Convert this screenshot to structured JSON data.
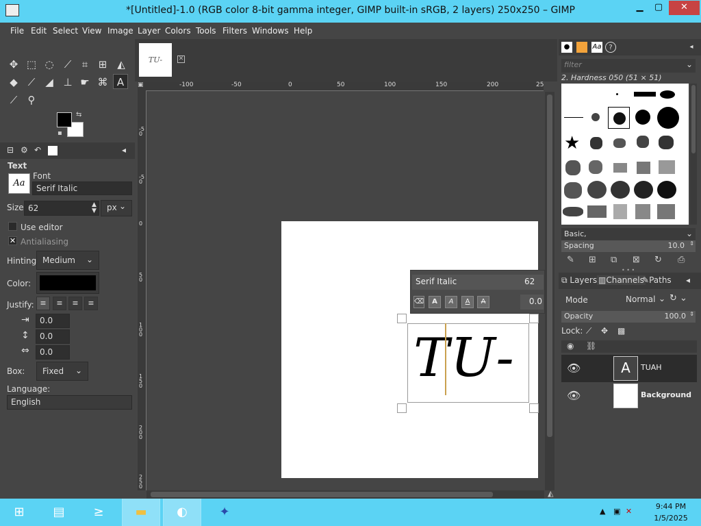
{
  "window": {
    "title": "*[Untitled]-1.0 (RGB color 8-bit gamma integer, GIMP built-in sRGB, 2 layers) 250x250 – GIMP",
    "minimize": "▁",
    "maximize": "▢",
    "close": "✕"
  },
  "menu": [
    "File",
    "Edit",
    "Select",
    "View",
    "Image",
    "Layer",
    "Colors",
    "Tools",
    "Filters",
    "Windows",
    "Help"
  ],
  "tool_options": {
    "title": "Text",
    "font_label": "Font",
    "font_icon": "Aa",
    "font_value": "Serif Italic",
    "size_label": "Size:",
    "size_value": "62",
    "size_unit": "px",
    "use_editor": "Use editor",
    "antialiasing": "Antialiasing",
    "hinting_label": "Hinting:",
    "hinting_value": "Medium",
    "color_label": "Color:",
    "justify_label": "Justify:",
    "indent_value": "0.0",
    "line_spacing_value": "0.0",
    "letter_spacing_value": "0.0",
    "box_label": "Box:",
    "box_value": "Fixed",
    "language_label": "Language:",
    "language_value": "English"
  },
  "ruler": {
    "h_labels": [
      "-100",
      "-50",
      "0",
      "50",
      "100",
      "150",
      "200",
      "25"
    ],
    "v_labels": [
      "0",
      "-50",
      "0",
      "50",
      "100",
      "150",
      "200",
      "250"
    ]
  },
  "thumbnail_text": "TU-",
  "text_toolbar": {
    "font": "Serif Italic",
    "size": "62",
    "baseline": "0.0"
  },
  "canvas_text": "TU-",
  "brushes": {
    "filter_placeholder": "filter",
    "selected": "2. Hardness 050 (51 × 51)",
    "tag": "Basic,",
    "spacing_label": "Spacing",
    "spacing_value": "10.0"
  },
  "layers": {
    "tabs": [
      "Layers",
      "Channels",
      "Paths"
    ],
    "mode_label": "Mode",
    "mode_value": "Normal",
    "opacity_label": "Opacity",
    "opacity_value": "100.0",
    "lock_label": "Lock:",
    "items": [
      {
        "name": "TUAH"
      },
      {
        "name": "Background"
      }
    ]
  },
  "taskbar": {
    "time": "9:44 PM",
    "date": "1/5/2025"
  }
}
